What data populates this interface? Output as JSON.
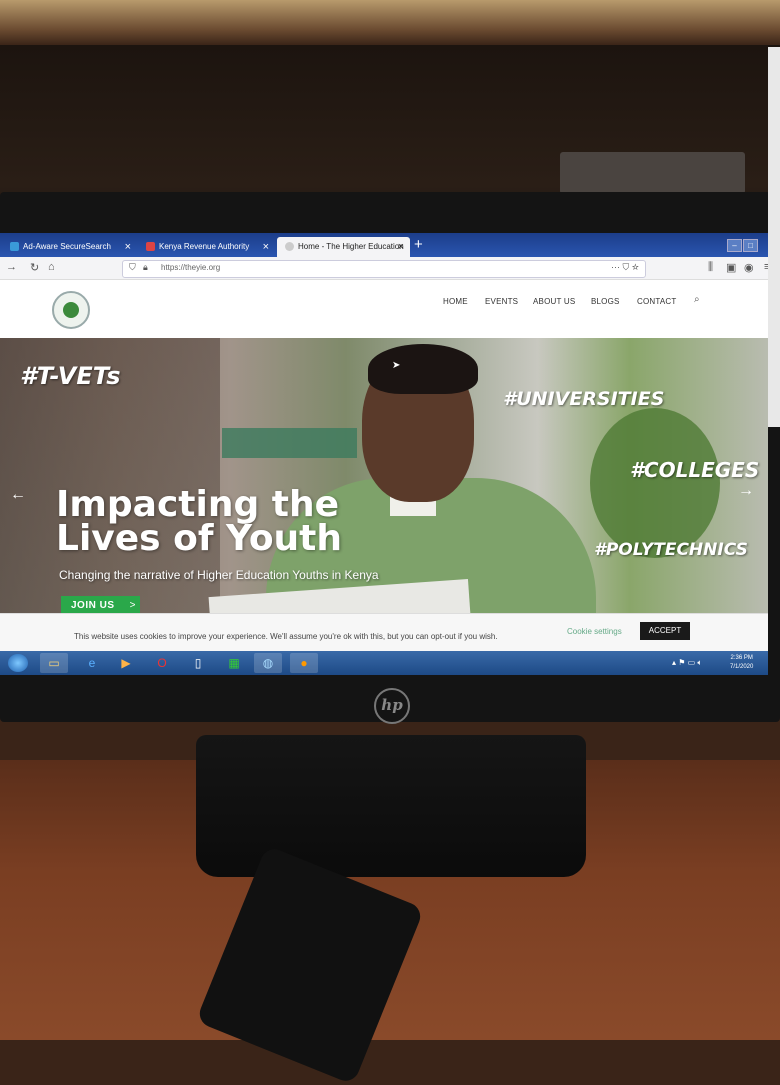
{
  "browser": {
    "tabs": [
      {
        "title": "Ad-Aware SecureSearch",
        "active": false
      },
      {
        "title": "Kenya Revenue Authority",
        "active": false
      },
      {
        "title": "Home - The Higher Education",
        "active": true
      }
    ],
    "new_tab": "+",
    "url": "https://theyie.org",
    "menu_dots": "···"
  },
  "site": {
    "nav": {
      "home": "HOME",
      "events": "EVENTS",
      "about": "ABOUT US",
      "blogs": "BLOGS",
      "contact": "CONTACT"
    },
    "hero": {
      "tags": {
        "tvets": "#T-VETs",
        "universities": "#UNIVERSITIES",
        "colleges": "#COLLEGES",
        "polytechnics": "#POLYTECHNICS"
      },
      "title_line1": "Impacting the",
      "title_line2": "Lives of Youth",
      "subtitle": "Changing the narrative of Higher Education Youths in Kenya",
      "cta": "JOIN US",
      "cta_chevron": ">"
    }
  },
  "cookie_bar": {
    "message": "This website uses cookies to improve your experience. We'll assume you're ok with this, but you can opt-out if you wish.",
    "settings": "Cookie settings",
    "accept": "ACCEPT"
  },
  "taskbar": {
    "time": "2:36 PM",
    "date": "7/1/2020"
  },
  "monitor": {
    "brand": "hp"
  },
  "colors": {
    "tab_bar": "#2a55b0",
    "cta_green": "#2aa84a",
    "accept_bg": "#1a1a1a"
  }
}
